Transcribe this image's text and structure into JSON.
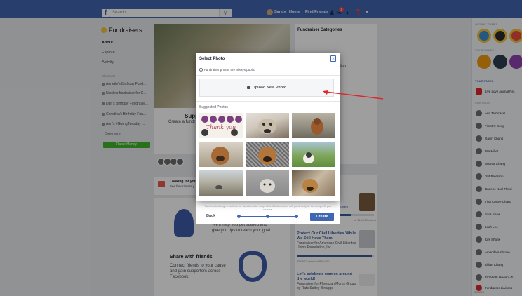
{
  "topbar": {
    "logo": "f",
    "search_placeholder": "Search",
    "search_icon": "search-icon",
    "profile_name": "Sandy",
    "nav_home": "Home",
    "nav_find_friends": "Find Friends",
    "notification_count": "1"
  },
  "leftnav": {
    "title": "Fundraisers",
    "items": [
      "About",
      "Explore",
      "Activity"
    ],
    "shortcuts_label": "Shortcuts",
    "shortcuts": [
      "Annette's Birthday Fund...",
      "Nicole's fundraiser for G...",
      "Dan's Birthday Fundraise...",
      "Christina's Birthday Fun...",
      "Ann's #GivingTuesday ..."
    ],
    "see_more": "See more",
    "raise_money": "Raise Money"
  },
  "main": {
    "support_title": "Supp",
    "support_text": "Create a fundr",
    "looking_title": "Looking for your",
    "looking_sub": "See fundraisers y",
    "help_text": "We'll help you get started and give you tips to reach your goal.",
    "share_title": "Share with friends",
    "share_text": "Connect friends to your cause and gain supporters across Facebook."
  },
  "right_column": {
    "categories_title": "Fundraiser Categories",
    "category_partial": "Action",
    "cause_1_partial": "lfugees",
    "cause_1_raised": "of $15,000 raised",
    "cause_2_title": "Protect Our Civil Liberties While We Still Have Them!",
    "cause_2_sub": "Fundraiser for American Civil Liberties Union Foundation, Inc.",
    "cause_2_raised": "$58,527 raised of $60,000",
    "cause_3_title": "Let's celebrate women around the world!",
    "cause_3_sub": "Fundraiser for Physician Moms Group by Rats Saltey-Binagge"
  },
  "sidebar": {
    "sponsored_games": "Instant Games",
    "your_games": "Your Games",
    "your_pages": "Your Pages",
    "page_name": "Live Love Animal Re...",
    "contacts_label": "Contacts",
    "contacts": [
      "Ann Ta Ocasel",
      "Timothy Song",
      "Gavin Chung",
      "Mia Miller",
      "Andrea Chang",
      "Ted Peterson",
      "Darlene Noel Floyd",
      "Irina Cortez-Chang",
      "Sara Shaw",
      "Leah Lee",
      "Kirk Shank",
      "Amanda Ambrose",
      "Lillian Chang",
      "Elizabeth Howard-Tu",
      "Fundraiser Liaisons"
    ],
    "search_placeholder": "Search"
  },
  "modal": {
    "title": "Select Photo",
    "public_note": "Fundraiser photos are always public.",
    "upload_label": "Upload New Photo",
    "suggested_label": "Suggested Photos",
    "thank_you_text": "Thank you",
    "footer_note": "Facebook charges no fees for donations to nonprofits. All donations will go directly to the nonprofit you choose.",
    "back_label": "Back",
    "create_label": "Create"
  },
  "colors": {
    "brand": "#4267b2",
    "raise_green": "#42b72a",
    "annotation_arrow": "#e0262a"
  }
}
